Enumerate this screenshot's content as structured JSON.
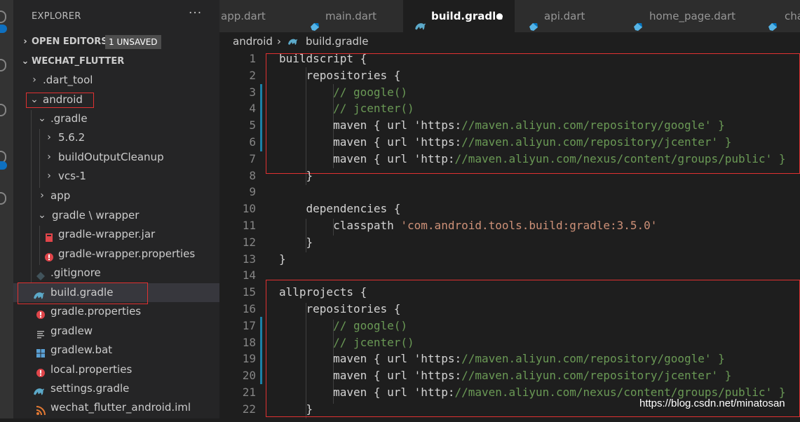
{
  "explorer": {
    "header": "EXPLORER",
    "more": "···",
    "open_editors": {
      "label": "OPEN EDITORS",
      "badge": "1 UNSAVED"
    },
    "project": {
      "label": "WECHAT_FLUTTER"
    },
    "items": [
      {
        "label": ".dart_tool",
        "chevron": "›",
        "icon": ""
      },
      {
        "label": "android",
        "chevron": "⌄",
        "icon": ""
      },
      {
        "label": ".gradle",
        "chevron": "⌄",
        "icon": ""
      },
      {
        "label": "5.6.2",
        "chevron": "›",
        "icon": ""
      },
      {
        "label": "buildOutputCleanup",
        "chevron": "›",
        "icon": ""
      },
      {
        "label": "vcs-1",
        "chevron": "›",
        "icon": ""
      },
      {
        "label": "app",
        "chevron": "›",
        "icon": ""
      },
      {
        "label": "gradle \\ wrapper",
        "chevron": "⌄",
        "icon": ""
      },
      {
        "label": "gradle-wrapper.jar",
        "chevron": "",
        "icon": "jar-icon"
      },
      {
        "label": "gradle-wrapper.properties",
        "chevron": "",
        "icon": "properties-icon"
      },
      {
        "label": ".gitignore",
        "chevron": "",
        "icon": "gitignore-icon"
      },
      {
        "label": "build.gradle",
        "chevron": "",
        "icon": "gradle-icon"
      },
      {
        "label": "gradle.properties",
        "chevron": "",
        "icon": "properties-icon"
      },
      {
        "label": "gradlew",
        "chevron": "",
        "icon": "text-file-icon"
      },
      {
        "label": "gradlew.bat",
        "chevron": "",
        "icon": "windows-icon"
      },
      {
        "label": "local.properties",
        "chevron": "",
        "icon": "properties-icon"
      },
      {
        "label": "settings.gradle",
        "chevron": "",
        "icon": "gradle-icon"
      },
      {
        "label": "wechat_flutter_android.iml",
        "chevron": "",
        "icon": "rss-icon"
      }
    ]
  },
  "tabs": [
    {
      "label": "app.dart",
      "icon": "dart-icon",
      "active": false
    },
    {
      "label": "main.dart",
      "icon": "dart-icon",
      "active": false
    },
    {
      "label": "build.gradle",
      "icon": "gradle-icon",
      "active": true,
      "unsaved": true
    },
    {
      "label": "api.dart",
      "icon": "dart-icon",
      "active": false
    },
    {
      "label": "home_page.dart",
      "icon": "dart-icon",
      "active": false
    },
    {
      "label": "cha",
      "icon": "dart-icon",
      "active": false
    }
  ],
  "breadcrumb": {
    "folder": "android",
    "separator": "›",
    "file": "build.gradle"
  },
  "code_lines": [
    {
      "n": "1",
      "text": "buildscript {"
    },
    {
      "n": "2",
      "text": "    repositories {"
    },
    {
      "n": "3",
      "text": "        // google()"
    },
    {
      "n": "4",
      "text": "        // jcenter()"
    },
    {
      "n": "5",
      "text": "        maven { url 'https://maven.aliyun.com/repository/google' }"
    },
    {
      "n": "6",
      "text": "        maven { url 'https://maven.aliyun.com/repository/jcenter' }"
    },
    {
      "n": "7",
      "text": "        maven { url 'http://maven.aliyun.com/nexus/content/groups/public' }"
    },
    {
      "n": "8",
      "text": "    }"
    },
    {
      "n": "9",
      "text": ""
    },
    {
      "n": "10",
      "text": "    dependencies {"
    },
    {
      "n": "11",
      "text": "        classpath 'com.android.tools.build:gradle:3.5.0'"
    },
    {
      "n": "12",
      "text": "    }"
    },
    {
      "n": "13",
      "text": "}"
    },
    {
      "n": "14",
      "text": ""
    },
    {
      "n": "15",
      "text": "allprojects {"
    },
    {
      "n": "16",
      "text": "    repositories {"
    },
    {
      "n": "17",
      "text": "        // google()"
    },
    {
      "n": "18",
      "text": "        // jcenter()"
    },
    {
      "n": "19",
      "text": "        maven { url 'https://maven.aliyun.com/repository/google' }"
    },
    {
      "n": "20",
      "text": "        maven { url 'https://maven.aliyun.com/repository/jcenter' }"
    },
    {
      "n": "21",
      "text": "        maven { url 'http://maven.aliyun.com/nexus/content/groups/public' }"
    },
    {
      "n": "22",
      "text": "    }"
    }
  ],
  "watermark": "https://blog.csdn.net/minatosan",
  "colors": {
    "accent": "#0e70c0",
    "highlight_box": "#e03131",
    "gradle_icon": "#5ca9c9",
    "dart_icon": "#56b4e6",
    "properties_icon": "#e0454a"
  }
}
